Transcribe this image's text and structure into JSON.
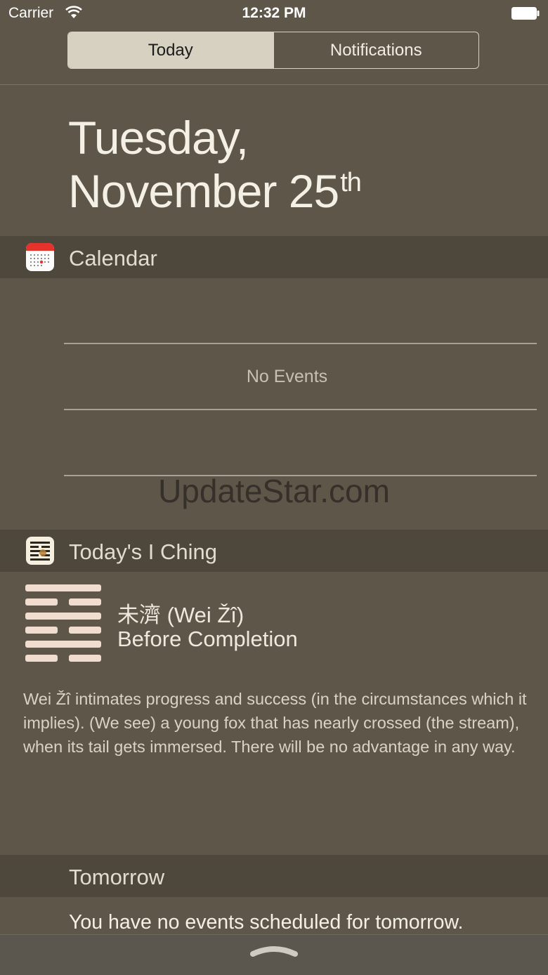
{
  "status_bar": {
    "carrier": "Carrier",
    "time": "12:32 PM"
  },
  "tabs": [
    {
      "label": "Today",
      "active": true
    },
    {
      "label": "Notifications",
      "active": false
    }
  ],
  "date": {
    "line1": "Tuesday,",
    "line2": "November 25",
    "suffix": "th"
  },
  "calendar": {
    "title": "Calendar",
    "empty_text": "No Events",
    "icon": "calendar-app-icon"
  },
  "watermark": "UpdateStar.com",
  "iching": {
    "title": "Today's I Ching",
    "icon": "iching-app-icon",
    "name": "未濟 (Wei Žî)",
    "subtitle": "Before Completion",
    "text": "Wei Žî intimates progress and success (in the circumstances which it implies). (We see) a young fox that has nearly crossed (the stream), when its tail gets immersed. There will be no advantage in any way."
  },
  "tomorrow": {
    "title": "Tomorrow",
    "text": "You have no events scheduled for tomorrow."
  },
  "colors": {
    "background": "#5e5749",
    "header": "#4d473c",
    "hexagram": "#f0ddd0"
  }
}
